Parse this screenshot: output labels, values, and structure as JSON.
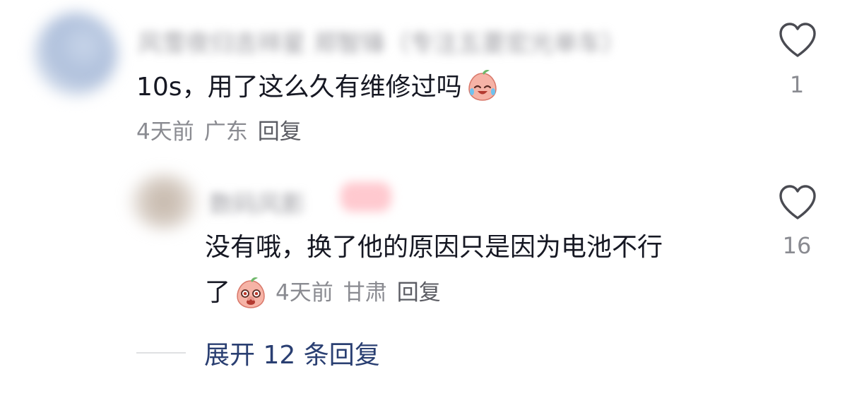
{
  "comment": {
    "author": "风雪夜归吉祥星 郑智锋（专注五菱宏光单车）",
    "text": "10s，用了这么久有维修过吗",
    "emoji": "crying-laughing-peach-emoji",
    "time": "4天前",
    "location": "广东",
    "reply_label": "回复",
    "like_count": "1"
  },
  "reply": {
    "author": "数码风影",
    "badge": "作者",
    "text_line1": "没有哦，换了他的原因只是因为电池不行",
    "text_line2": "了",
    "emoji": "shy-peach-emoji",
    "time": "4天前",
    "location": "甘肃",
    "reply_label": "回复",
    "like_count": "16"
  },
  "expand": {
    "label": "展开 12 条回复"
  },
  "colors": {
    "text_primary": "#161823",
    "text_secondary": "#8a8b91",
    "link": "#2a3f72",
    "heart_outline": "#4a4b52"
  }
}
